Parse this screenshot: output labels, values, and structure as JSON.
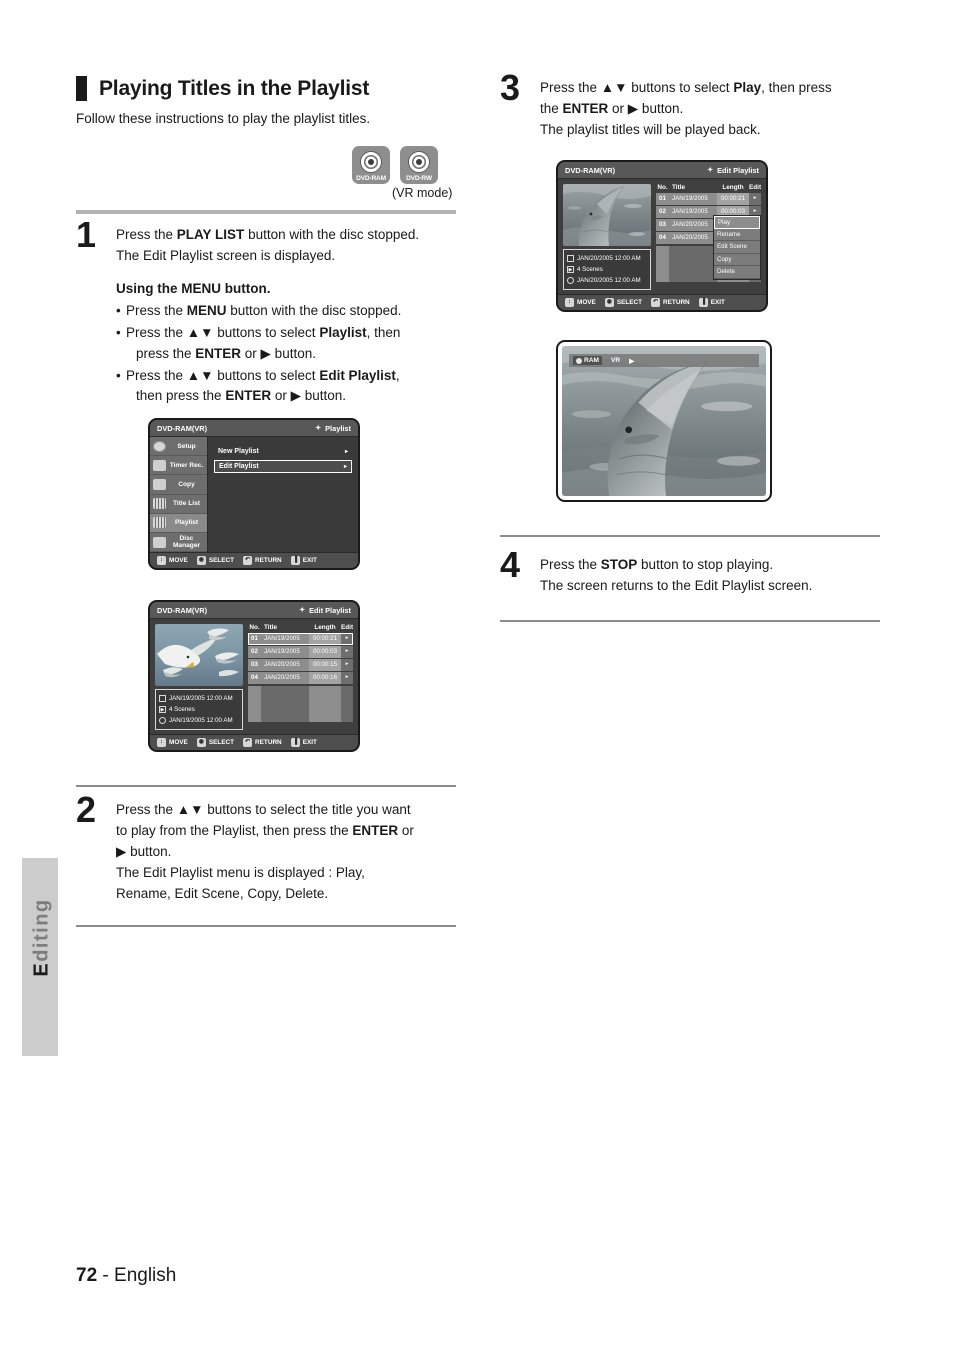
{
  "page": {
    "number": "72",
    "language": "English",
    "side_tab": "Editing"
  },
  "section": {
    "title": "Playing Titles in the Playlist",
    "subtitle": "Follow these instructions to play the playlist titles.",
    "disc_logos": [
      {
        "label": "DVD-RAM"
      },
      {
        "label": "DVD-RW"
      }
    ],
    "mode_note": "(VR mode)"
  },
  "steps": {
    "step1": {
      "number": "1",
      "line1_pre": "Press the ",
      "line1_bold": "PLAY LIST",
      "line1_post": " button with the disc stopped.",
      "line2": "The Edit Playlist screen is displayed.",
      "sub_head": "Using the MENU button.",
      "bullets": [
        {
          "pre": "Press the ",
          "bold": "MENU",
          "post": " button with the disc stopped."
        },
        {
          "pre": "Press the ▲▼ buttons to select ",
          "bold": "Playlist",
          "post": ", then"
        },
        {
          "cont": "press the ",
          "cont_bold": "ENTER",
          "cont_post": " or ▶ button."
        },
        {
          "pre": "Press the ▲▼ buttons to select ",
          "bold": "Edit Playlist",
          "post": ","
        },
        {
          "cont": "then press the ",
          "cont_bold": "ENTER",
          "cont_post": " or ▶ button."
        }
      ]
    },
    "step2": {
      "number": "2",
      "line1": "Press the ▲▼ buttons to select the title you want",
      "line2_pre": "to play from the Playlist, then press the ",
      "line2_bold": "ENTER",
      "line2_post": " or",
      "line3": "▶ button.",
      "line4": "The Edit Playlist menu is displayed : Play,",
      "line5": "Rename, Edit Scene, Copy, Delete."
    },
    "step3": {
      "number": "3",
      "line1_pre": "Press the ▲▼ buttons to select ",
      "line1_bold": "Play",
      "line1_post": ", then press",
      "line2_pre": "the ",
      "line2_bold": "ENTER",
      "line2_post": " or ▶ button.",
      "line3": "The playlist titles will be played back."
    },
    "step4": {
      "number": "4",
      "line1_pre": "Press the ",
      "line1_bold": "STOP",
      "line1_post": " button to stop playing.",
      "line2": "The screen returns to the Edit Playlist screen."
    }
  },
  "osd_controls": [
    {
      "icon": "updown-icon",
      "glyph": "↕",
      "label": "MOVE"
    },
    {
      "icon": "enter-icon",
      "glyph": "◉",
      "label": "SELECT"
    },
    {
      "icon": "return-icon",
      "glyph": "↶",
      "label": "RETURN"
    },
    {
      "icon": "exit-icon",
      "glyph": "▐",
      "label": "EXIT"
    }
  ],
  "screen_playlist_menu": {
    "disc_type": "DVD-RAM(VR)",
    "title": "Playlist",
    "sidebar": [
      {
        "label": "Setup",
        "icon": "gear-icon",
        "selected": false
      },
      {
        "label": "Timer Rec.",
        "icon": "clock-icon",
        "selected": false
      },
      {
        "label": "Copy",
        "icon": "copy-icon",
        "selected": false
      },
      {
        "label": "Title List",
        "icon": "film-icon",
        "selected": false
      },
      {
        "label": "Playlist",
        "icon": "playlist-icon",
        "selected": true
      },
      {
        "label": "Disc Manager",
        "icon": "disc-icon",
        "selected": false
      }
    ],
    "items": [
      {
        "label": "New Playlist",
        "selected": false
      },
      {
        "label": "Edit Playlist",
        "selected": true
      }
    ]
  },
  "screen_edit_playlist": {
    "disc_type": "DVD-RAM(VR)",
    "title": "Edit Playlist",
    "thumbnail": "seagulls",
    "columns": [
      "No.",
      "Title",
      "Length",
      "Edit"
    ],
    "rows": [
      {
        "no": "01",
        "title": "JAN/19/2005",
        "length": "00:00:21",
        "selected": true
      },
      {
        "no": "02",
        "title": "JAN/19/2005",
        "length": "00:00:03",
        "selected": false
      },
      {
        "no": "03",
        "title": "JAN/20/2005",
        "length": "00:00:15",
        "selected": false
      },
      {
        "no": "04",
        "title": "JAN/20/2005",
        "length": "00:00:16",
        "selected": false
      }
    ],
    "info": [
      {
        "icon": "frame-icon",
        "text": "JAN/19/2005 12:00 AM"
      },
      {
        "icon": "scenes-icon",
        "text": "4 Scenes"
      },
      {
        "icon": "clock-icon",
        "text": "JAN/19/2005 12:00 AM"
      }
    ]
  },
  "screen_edit_playlist_menu": {
    "disc_type": "DVD-RAM(VR)",
    "title": "Edit Playlist",
    "thumbnail": "dolphin",
    "columns": [
      "No.",
      "Title",
      "Length",
      "Edit"
    ],
    "rows": [
      {
        "no": "01",
        "title": "JAN/19/2005",
        "length": "00:00:21",
        "selected": false
      },
      {
        "no": "02",
        "title": "JAN/19/2005",
        "length": "00:00:03",
        "selected": false
      },
      {
        "no": "03",
        "title": "JAN/20/2005",
        "length": "",
        "selected": false
      },
      {
        "no": "04",
        "title": "JAN/20/2005",
        "length": "",
        "selected": false
      }
    ],
    "popup": [
      {
        "label": "Play",
        "selected": true
      },
      {
        "label": "Rename",
        "selected": false
      },
      {
        "label": "Edit Scene",
        "selected": false
      },
      {
        "label": "Copy",
        "selected": false
      },
      {
        "label": "Delete",
        "selected": false
      }
    ],
    "info": [
      {
        "icon": "frame-icon",
        "text": "JAN/20/2005 12:00 AM"
      },
      {
        "icon": "scenes-icon",
        "text": "4 Scenes"
      },
      {
        "icon": "clock-icon",
        "text": "JAN/20/2005 12:00 AM"
      }
    ]
  },
  "screen_playback": {
    "disc_badge": "RAM",
    "mode": "VR",
    "state_icon": "play-icon",
    "thumbnail": "dolphin"
  }
}
